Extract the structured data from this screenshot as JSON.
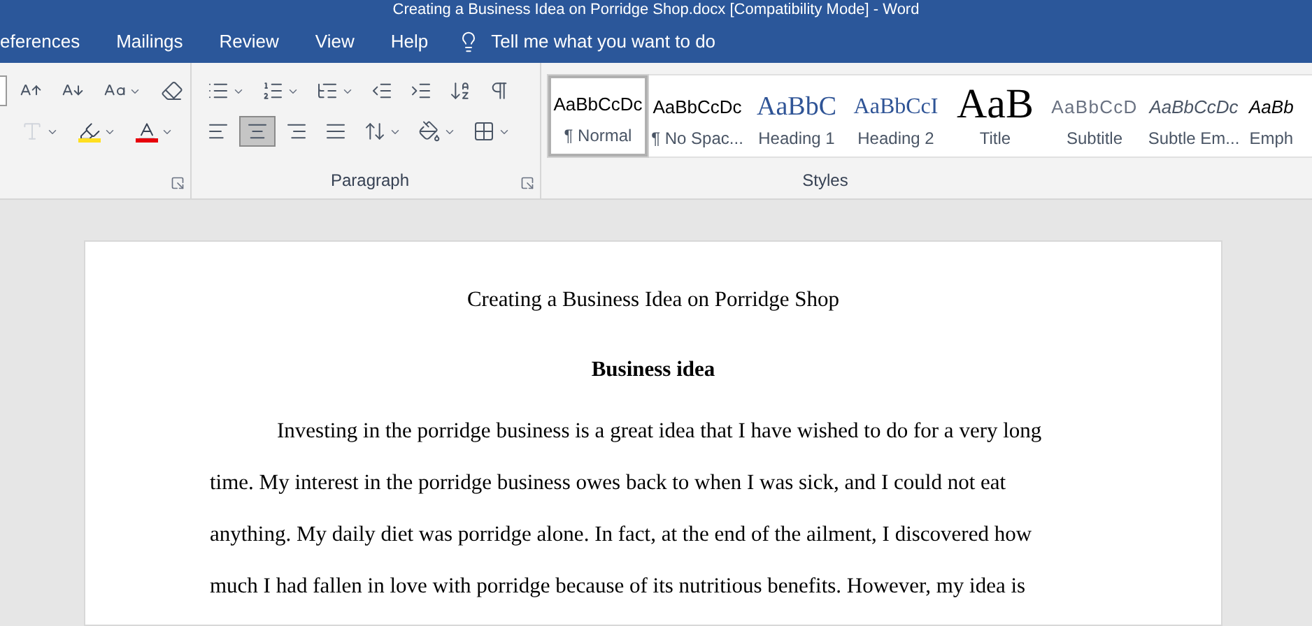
{
  "window": {
    "title": "Creating a Business Idea on Porridge Shop.docx [Compatibility Mode]  -  Word"
  },
  "tabs": [
    {
      "label": "eferences",
      "selected": false
    },
    {
      "label": "Mailings",
      "selected": false
    },
    {
      "label": "Review",
      "selected": false
    },
    {
      "label": "View",
      "selected": false
    },
    {
      "label": "Help",
      "selected": false
    }
  ],
  "tell_me": {
    "placeholder": "Tell me what you want to do"
  },
  "font_group": {
    "row_1": [
      {
        "dropdown": false,
        "disabled": false
      },
      {
        "dropdown": false,
        "disabled": false
      },
      {
        "dropdown": true,
        "disabled": false
      },
      {
        "dropdown": false,
        "disabled": false
      }
    ],
    "row_2": [
      {
        "dropdown": true,
        "disabled": true
      },
      {
        "dropdown": true,
        "disabled": false
      },
      {
        "dropdown": true,
        "disabled": false
      }
    ]
  },
  "paragraph_group": {
    "label": "Paragraph",
    "row_1": [
      {
        "dropdown": true,
        "selected": false
      },
      {
        "dropdown": true,
        "selected": false
      },
      {
        "dropdown": true,
        "selected": false
      },
      {
        "dropdown": false,
        "selected": false
      },
      {
        "dropdown": false,
        "selected": false
      },
      {
        "dropdown": false,
        "selected": false
      },
      {
        "dropdown": false,
        "selected": false
      }
    ],
    "row_2": [
      {
        "dropdown": false,
        "selected": false
      },
      {
        "dropdown": false,
        "selected": true
      },
      {
        "dropdown": false,
        "selected": false
      },
      {
        "dropdown": false,
        "selected": false
      },
      {
        "dropdown": true,
        "selected": false
      },
      {
        "dropdown": true,
        "selected": false
      },
      {
        "dropdown": true,
        "selected": false
      }
    ]
  },
  "styles_group": {
    "label": "Styles",
    "items": [
      {
        "preview": "AaBbCcDc",
        "name": "¶ Normal",
        "selected": true,
        "kind": "normal"
      },
      {
        "preview": "AaBbCcDc",
        "name": "¶ No Spac...",
        "selected": false,
        "kind": "normal"
      },
      {
        "preview": "AaBbC",
        "name": "Heading 1",
        "selected": false,
        "kind": "heading1"
      },
      {
        "preview": "AaBbCcI",
        "name": "Heading 2",
        "selected": false,
        "kind": "heading2"
      },
      {
        "preview": "AaB",
        "name": "Title",
        "selected": false,
        "kind": "title"
      },
      {
        "preview": "AaBbCcD",
        "name": "Subtitle",
        "selected": false,
        "kind": "subtitle"
      },
      {
        "preview": "AaBbCcDc",
        "name": "Subtle Em...",
        "selected": false,
        "kind": "subtle"
      },
      {
        "preview": "AaBb",
        "name": "Emph",
        "selected": false,
        "kind": "emphasis"
      }
    ]
  },
  "document": {
    "title": "Creating a Business Idea on Porridge Shop",
    "heading": "Business idea",
    "paragraph": "Investing in the porridge business is a great idea that I have wished to do for a very long time. My interest in the porridge business owes back to when I was sick, and I could not eat anything. My daily diet was porridge alone. In fact, at the end of the ailment, I discovered how much I had fallen in love with porridge because of its nutritious benefits. However, my idea is"
  }
}
